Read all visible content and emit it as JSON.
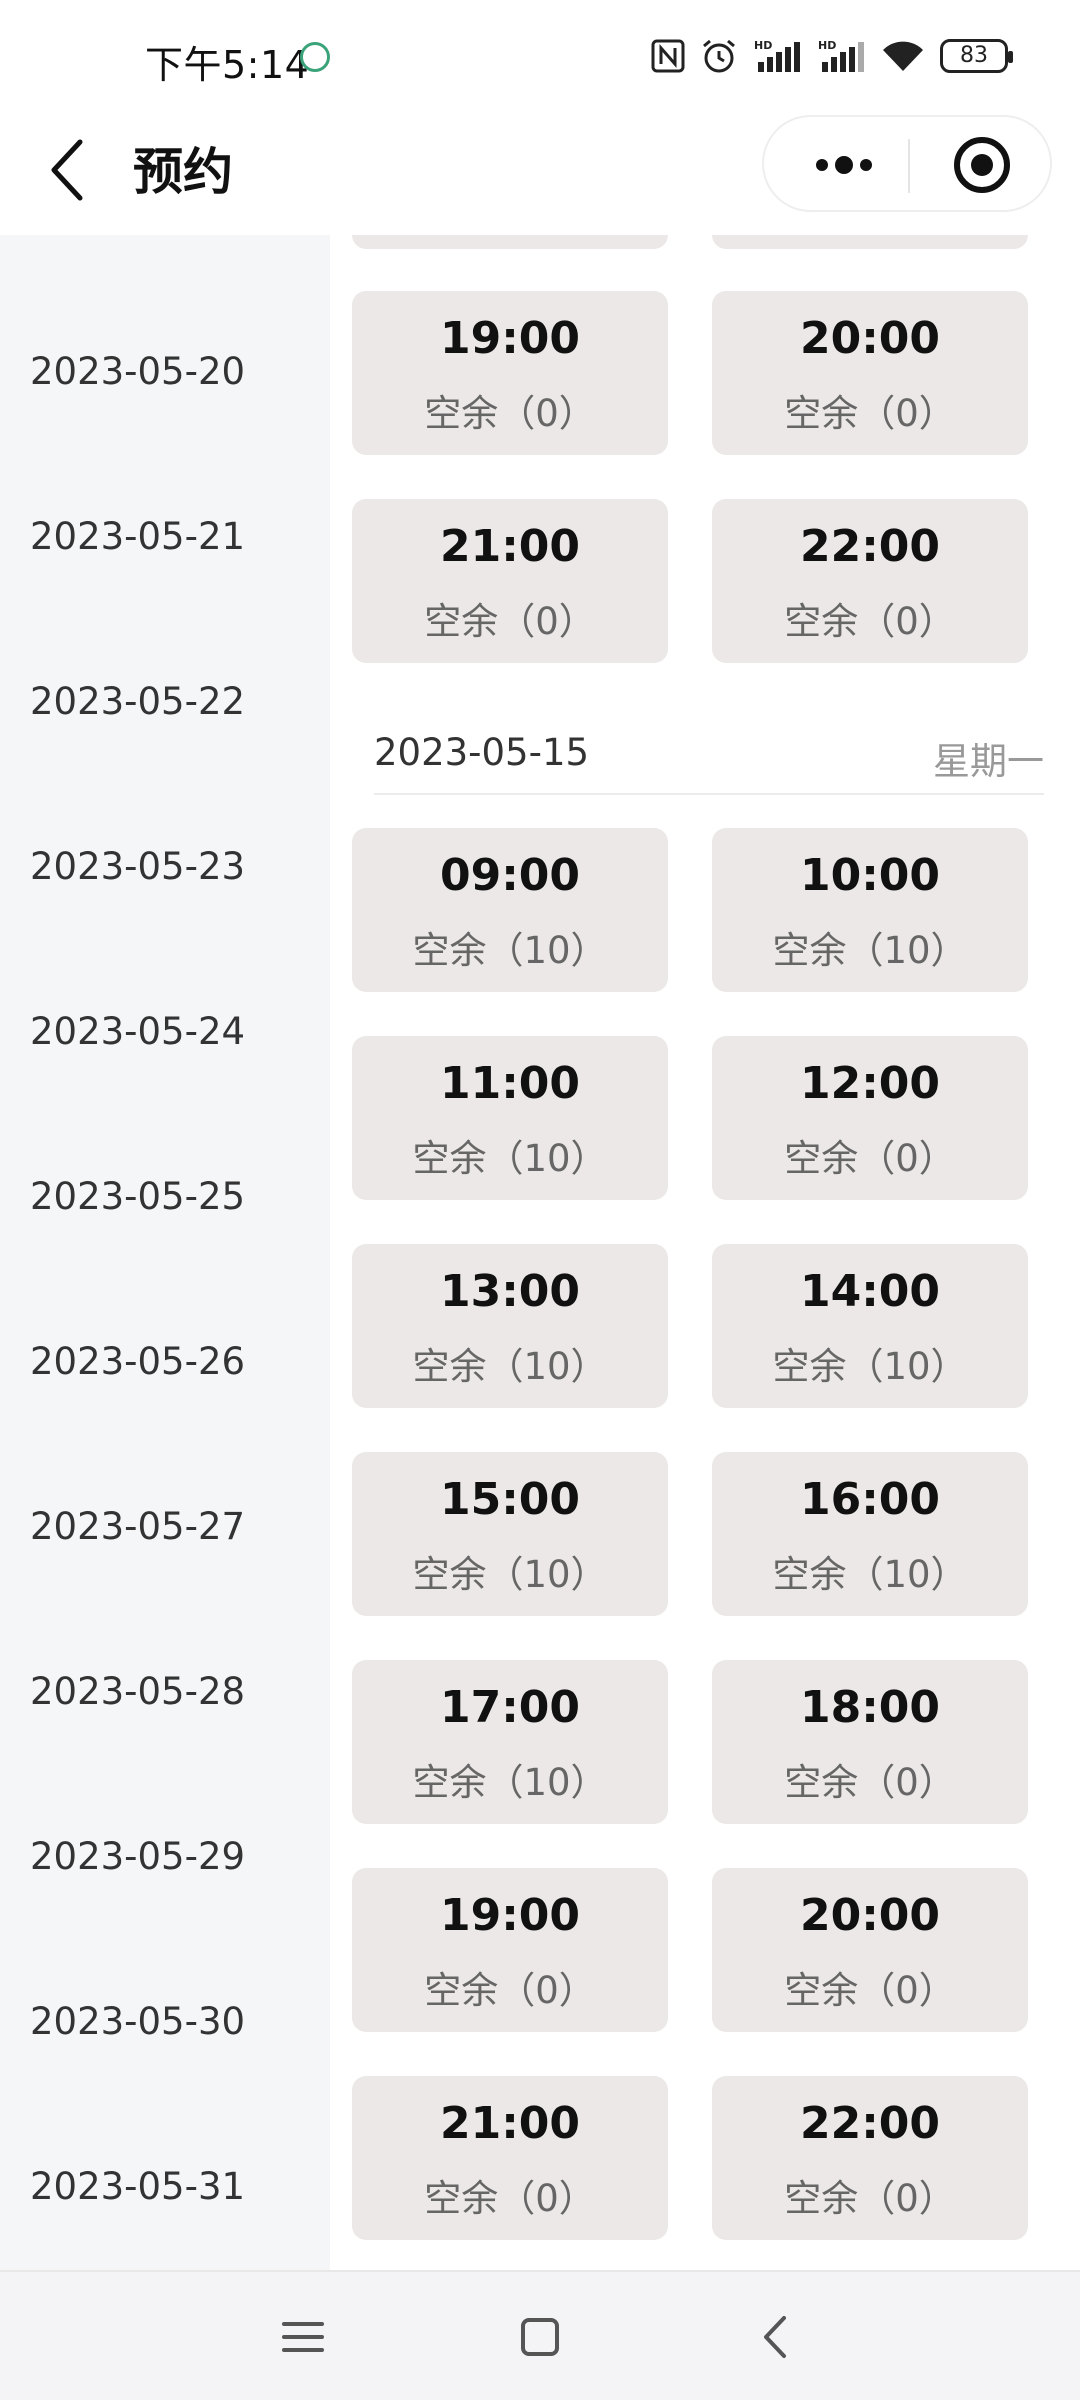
{
  "status_bar": {
    "time": "下午5:14",
    "battery": "83",
    "icons": [
      "nfc-icon",
      "alarm-icon",
      "hd-signal-icon",
      "hd-signal-icon",
      "wifi-icon",
      "battery-icon"
    ]
  },
  "nav": {
    "title": "预约",
    "back_icon": "chevron-left-icon",
    "more_icon": "more-dots-icon",
    "target_icon": "target-icon"
  },
  "sidebar": {
    "dates": [
      "2023-05-20",
      "2023-05-21",
      "2023-05-22",
      "2023-05-23",
      "2023-05-24",
      "2023-05-25",
      "2023-05-26",
      "2023-05-27",
      "2023-05-28",
      "2023-05-29",
      "2023-05-30",
      "2023-05-31"
    ]
  },
  "content": {
    "top_slots": [
      {
        "time": "19:00",
        "remain": "空余（0）"
      },
      {
        "time": "20:00",
        "remain": "空余（0）"
      },
      {
        "time": "21:00",
        "remain": "空余（0）"
      },
      {
        "time": "22:00",
        "remain": "空余（0）"
      }
    ],
    "day": {
      "date": "2023-05-15",
      "weekday": "星期一",
      "slots": [
        {
          "time": "09:00",
          "remain": "空余（10）"
        },
        {
          "time": "10:00",
          "remain": "空余（10）"
        },
        {
          "time": "11:00",
          "remain": "空余（10）"
        },
        {
          "time": "12:00",
          "remain": "空余（0）"
        },
        {
          "time": "13:00",
          "remain": "空余（10）"
        },
        {
          "time": "14:00",
          "remain": "空余（10）"
        },
        {
          "time": "15:00",
          "remain": "空余（10）"
        },
        {
          "time": "16:00",
          "remain": "空余（10）"
        },
        {
          "time": "17:00",
          "remain": "空余（10）"
        },
        {
          "time": "18:00",
          "remain": "空余（0）"
        },
        {
          "time": "19:00",
          "remain": "空余（0）"
        },
        {
          "time": "20:00",
          "remain": "空余（0）"
        },
        {
          "time": "21:00",
          "remain": "空余（0）"
        },
        {
          "time": "22:00",
          "remain": "空余（0）"
        }
      ]
    }
  },
  "bottom_nav": {
    "menu_icon": "menu-icon",
    "home_icon": "home-square-icon",
    "back_icon": "back-chevron-icon"
  },
  "colors": {
    "slot_bg": "#ede8e8",
    "sidebar_bg": "#f5f6f8",
    "text_primary": "#111111",
    "text_secondary": "#666666"
  }
}
